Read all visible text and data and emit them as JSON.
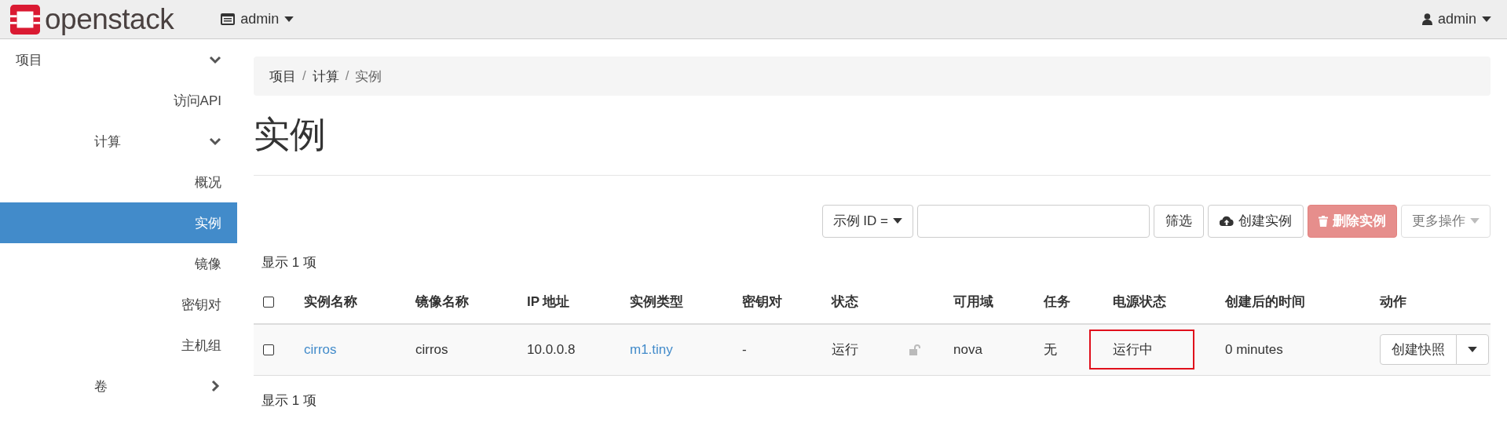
{
  "topbar": {
    "brand": "openstack",
    "project_menu": "admin",
    "user_menu": "admin"
  },
  "sidebar": {
    "items": [
      {
        "label": "项目",
        "kind": "section",
        "expanded": true,
        "children": [
          {
            "label": "访问API",
            "kind": "link",
            "selected": false
          },
          {
            "label": "计算",
            "kind": "group",
            "expanded": true,
            "children": [
              {
                "label": "概况",
                "kind": "link",
                "selected": false
              },
              {
                "label": "实例",
                "kind": "link",
                "selected": true
              },
              {
                "label": "镜像",
                "kind": "link",
                "selected": false
              },
              {
                "label": "密钥对",
                "kind": "link",
                "selected": false
              },
              {
                "label": "主机组",
                "kind": "link",
                "selected": false
              }
            ]
          },
          {
            "label": "卷",
            "kind": "group",
            "expanded": false
          }
        ]
      }
    ]
  },
  "breadcrumb": [
    {
      "text": "项目",
      "kind": "item"
    },
    {
      "text": "/",
      "kind": "separator"
    },
    {
      "text": "计算",
      "kind": "item"
    },
    {
      "text": "/",
      "kind": "separator"
    },
    {
      "text": "实例",
      "kind": "current"
    }
  ],
  "page_title": "实例",
  "toolbar": {
    "filter_field": "示例 ID =",
    "buttons": [
      {
        "label": "筛选",
        "kind": "plain",
        "disabled": false
      },
      {
        "label": "创建实例",
        "kind": "create",
        "disabled": false
      },
      {
        "label": "删除实例",
        "kind": "danger",
        "disabled": true
      },
      {
        "label": "更多操作",
        "kind": "menu",
        "disabled": true
      }
    ]
  },
  "table": {
    "count_top": "显示 1 项",
    "count_bottom": "显示 1 项",
    "header_checked": false,
    "columns": [
      "实例名称",
      "镜像名称",
      "IP 地址",
      "实例类型",
      "密钥对",
      "状态",
      "可用域",
      "任务",
      "电源状态",
      "创建后的时间",
      "动作"
    ],
    "rows": [
      {
        "checked": false,
        "cells": [
          {
            "text": "cirros",
            "kind": "link"
          },
          {
            "text": "cirros",
            "kind": "text"
          },
          {
            "text": "10.0.0.8",
            "kind": "text"
          },
          {
            "text": "m1.tiny",
            "kind": "link"
          },
          {
            "text": "-",
            "kind": "text"
          },
          {
            "text": "运行",
            "kind": "status",
            "locked": false
          },
          {
            "text": "nova",
            "kind": "text"
          },
          {
            "text": "无",
            "kind": "text"
          },
          {
            "text": "运行中",
            "kind": "text",
            "highlighted": true
          },
          {
            "text": "0 minutes",
            "kind": "text"
          },
          {
            "text": "创建快照",
            "kind": "action"
          }
        ]
      }
    ]
  }
}
